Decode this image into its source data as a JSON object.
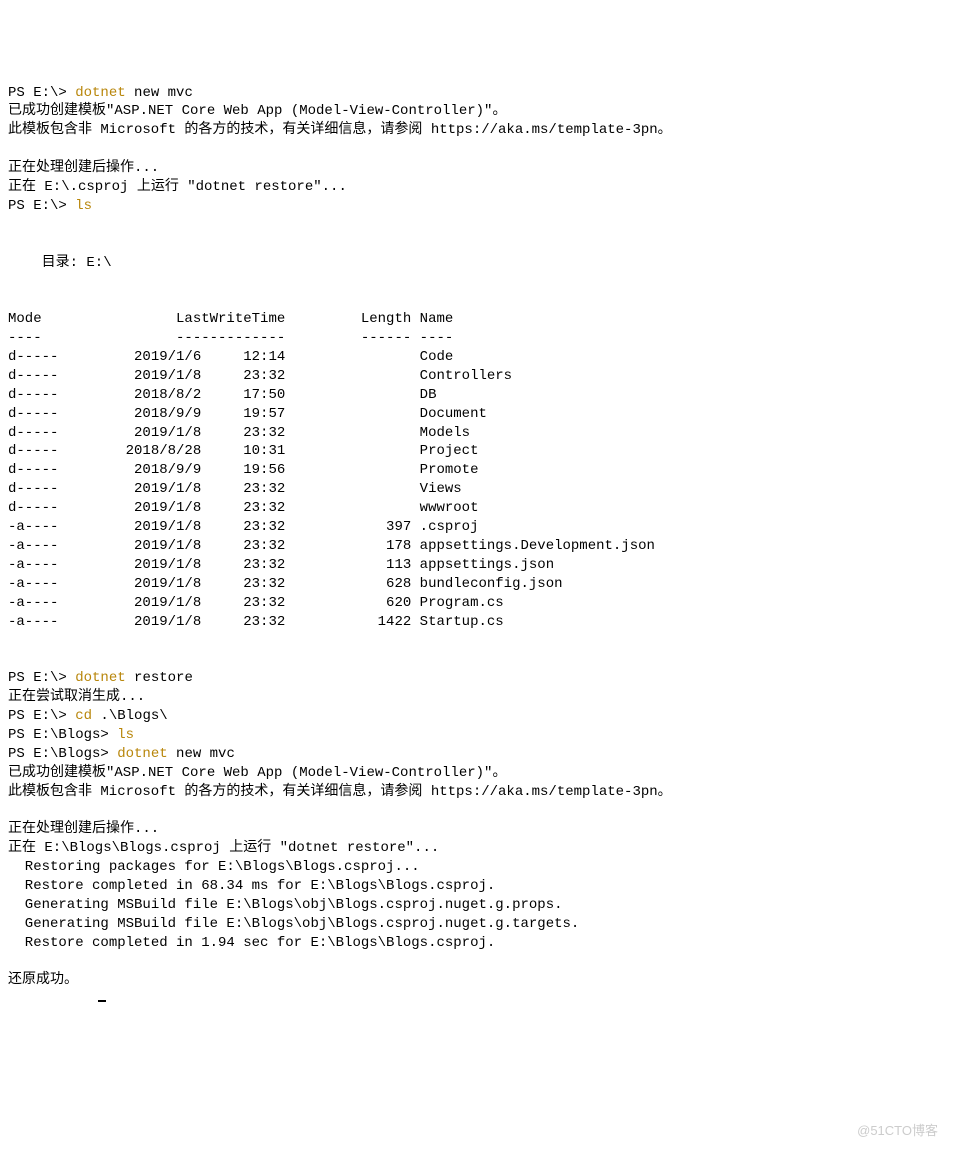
{
  "line1_prompt": "PS E:\\> ",
  "line1_cmd": "dotnet",
  "line1_args": " new mvc",
  "line2": "已成功创建模板\"ASP.NET Core Web App (Model-View-Controller)\"。",
  "line3": "此模板包含非 Microsoft 的各方的技术，有关详细信息，请参阅 https://aka.ms/template-3pn。",
  "blank": "",
  "line4": "正在处理创建后操作...",
  "line5": "正在 E:\\.csproj 上运行 \"dotnet restore\"...",
  "line6_prompt": "PS E:\\> ",
  "line6_cmd": "ls",
  "dir_header": "    目录: E:\\",
  "table_header": "Mode                LastWriteTime         Length Name",
  "table_divider": "----                -------------         ------ ----",
  "rows": [
    "d-----         2019/1/6     12:14                Code",
    "d-----         2019/1/8     23:32                Controllers",
    "d-----         2018/8/2     17:50                DB",
    "d-----         2018/9/9     19:57                Document",
    "d-----         2019/1/8     23:32                Models",
    "d-----        2018/8/28     10:31                Project",
    "d-----         2018/9/9     19:56                Promote",
    "d-----         2019/1/8     23:32                Views",
    "d-----         2019/1/8     23:32                wwwroot",
    "-a----         2019/1/8     23:32            397 .csproj",
    "-a----         2019/1/8     23:32            178 appsettings.Development.json",
    "-a----         2019/1/8     23:32            113 appsettings.json",
    "-a----         2019/1/8     23:32            628 bundleconfig.json",
    "-a----         2019/1/8     23:32            620 Program.cs",
    "-a----         2019/1/8     23:32           1422 Startup.cs"
  ],
  "line7_prompt": "PS E:\\> ",
  "line7_cmd": "dotnet",
  "line7_args": " restore",
  "line8": "正在尝试取消生成...",
  "line9_prompt": "PS E:\\> ",
  "line9_cmd": "cd",
  "line9_args": " .\\Blogs\\",
  "line10_prompt": "PS E:\\Blogs> ",
  "line10_cmd": "ls",
  "line11_prompt": "PS E:\\Blogs> ",
  "line11_cmd": "dotnet",
  "line11_args": " new mvc",
  "line12": "已成功创建模板\"ASP.NET Core Web App (Model-View-Controller)\"。",
  "line13": "此模板包含非 Microsoft 的各方的技术，有关详细信息，请参阅 https://aka.ms/template-3pn。",
  "line14": "正在处理创建后操作...",
  "line15": "正在 E:\\Blogs\\Blogs.csproj 上运行 \"dotnet restore\"...",
  "line16": "  Restoring packages for E:\\Blogs\\Blogs.csproj...",
  "line17": "  Restore completed in 68.34 ms for E:\\Blogs\\Blogs.csproj.",
  "line18": "  Generating MSBuild file E:\\Blogs\\obj\\Blogs.csproj.nuget.g.props.",
  "line19": "  Generating MSBuild file E:\\Blogs\\obj\\Blogs.csproj.nuget.g.targets.",
  "line20": "  Restore completed in 1.94 sec for E:\\Blogs\\Blogs.csproj.",
  "line21": "还原成功。",
  "watermark": "@51CTO博客"
}
